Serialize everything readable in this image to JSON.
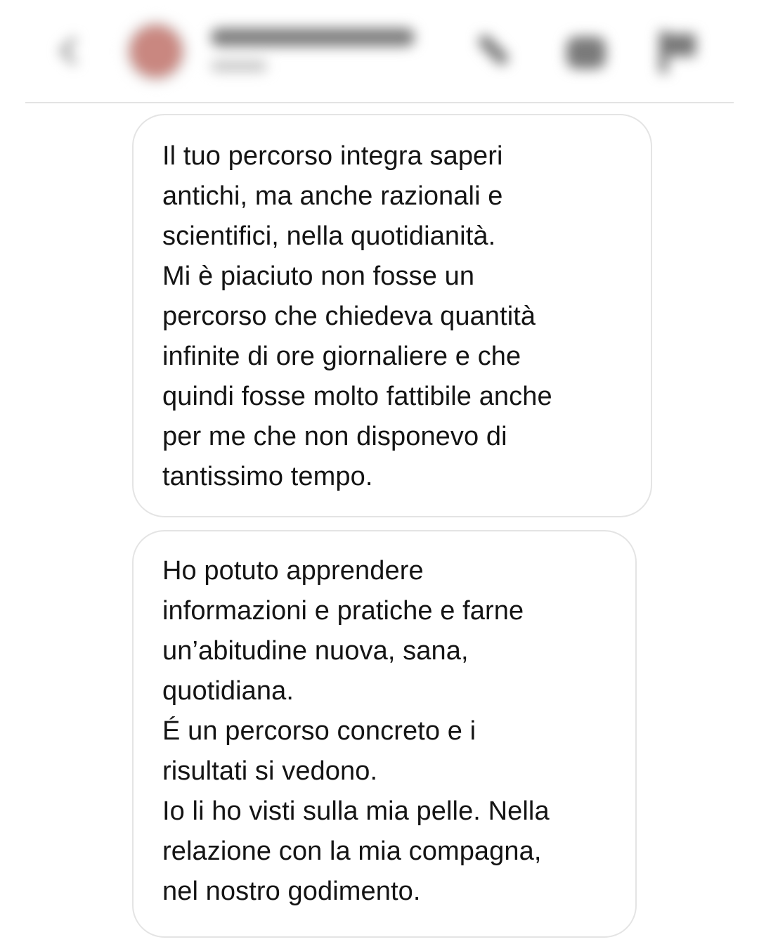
{
  "header": {
    "back_icon": "chevron-left-icon",
    "phone_icon": "phone-icon",
    "video_icon": "video-camera-icon",
    "flag_icon": "flag-icon"
  },
  "messages": [
    {
      "text": "Il tuo percorso integra saperi\nantichi, ma anche razionali e\nscientifici, nella quotidianità.\nMi è piaciuto non fosse un\npercorso che chiedeva quantità\ninfinite di ore giornaliere e che\nquindi fosse molto fattibile anche\nper me che non disponevo di\ntantissimo tempo."
    },
    {
      "text": "Ho potuto apprendere\ninformazioni e pratiche e farne\nun’abitudine nuova, sana,\nquotidiana.\nÉ un percorso concreto e i\nrisultati si vedono.\nIo li ho visti sulla mia pelle. Nella\nrelazione con la mia compagna,\nnel nostro godimento."
    }
  ]
}
